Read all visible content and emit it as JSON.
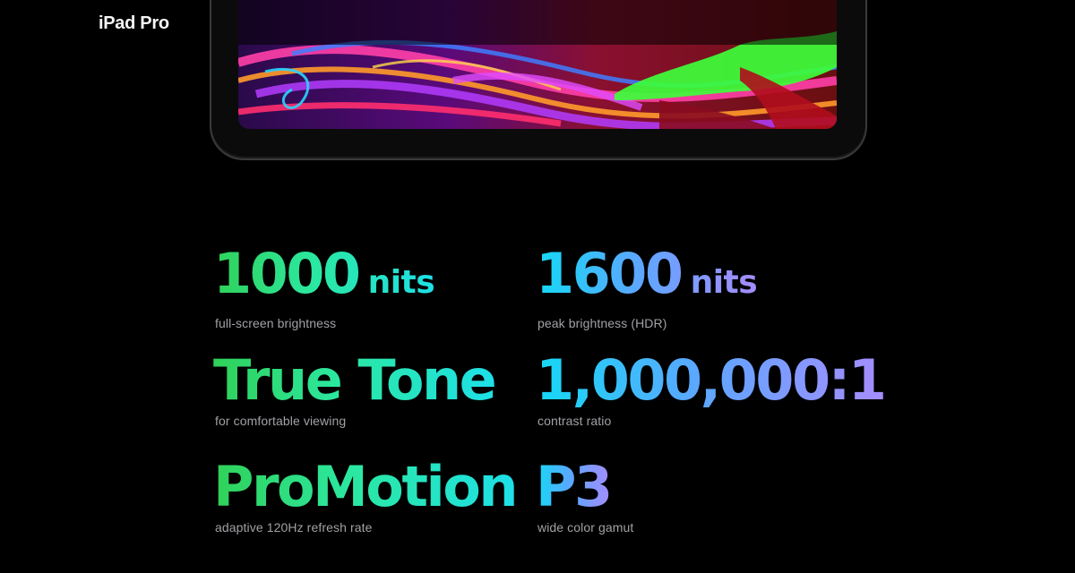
{
  "header": {
    "product_title": "iPad Pro"
  },
  "stats": [
    {
      "value": "1000",
      "unit": "nits",
      "caption": "full-screen brightness"
    },
    {
      "value": "1600",
      "unit": "nits",
      "caption": "peak brightness (HDR)"
    },
    {
      "value": "True Tone",
      "unit": "",
      "caption": "for comfortable viewing"
    },
    {
      "value": "1,000,000:1",
      "unit": "",
      "caption": "contrast ratio"
    },
    {
      "value": "ProMotion",
      "unit": "",
      "caption": "adaptive 120Hz refresh rate"
    },
    {
      "value": "P3",
      "unit": "",
      "caption": "wide color gamut"
    }
  ],
  "colors": {
    "background": "#000000",
    "caption": "#a1a1a6",
    "gradient_left": [
      "#30d158",
      "#1ee0e8"
    ],
    "gradient_right": [
      "#14d9f5",
      "#a68cff"
    ]
  }
}
